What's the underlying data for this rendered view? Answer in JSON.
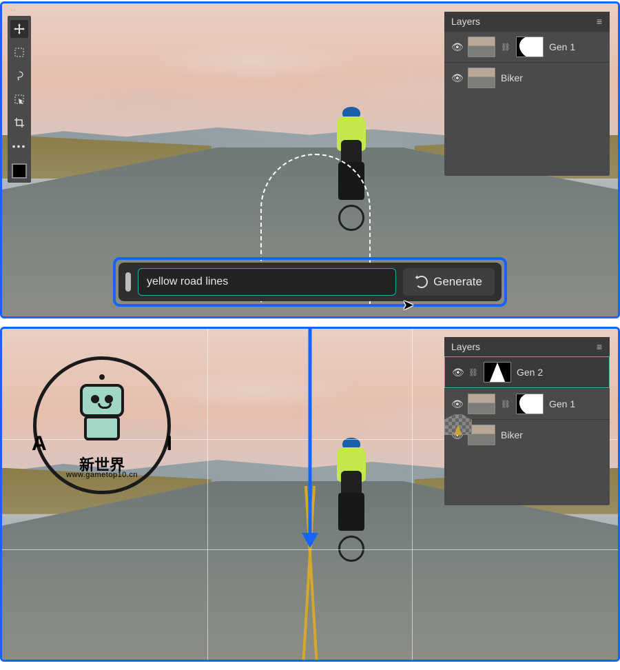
{
  "gen_bar": {
    "prompt_value": "yellow road lines",
    "button_label": "Generate"
  },
  "toolbox": {
    "tools": [
      "move",
      "marquee",
      "lasso",
      "object-select",
      "crop",
      "more"
    ]
  },
  "panel_top": {
    "title": "Layers",
    "layers": [
      {
        "name": "Gen 1",
        "visible": true,
        "has_mask": true,
        "mask_shape": "blob"
      },
      {
        "name": "Biker",
        "visible": true,
        "has_mask": false
      }
    ]
  },
  "panel_bottom": {
    "title": "Layers",
    "layers": [
      {
        "name": "Gen 2",
        "visible": true,
        "has_mask": true,
        "mask_shape": "tri",
        "selected": true
      },
      {
        "name": "Gen 1",
        "visible": true,
        "has_mask": true,
        "mask_shape": "blob"
      },
      {
        "name": "Biker",
        "visible": true,
        "has_mask": false
      }
    ]
  },
  "watermark": {
    "left_letter": "A",
    "right_letter": "I",
    "text_cn": "新世界",
    "url": "www.gametop10.cn"
  }
}
